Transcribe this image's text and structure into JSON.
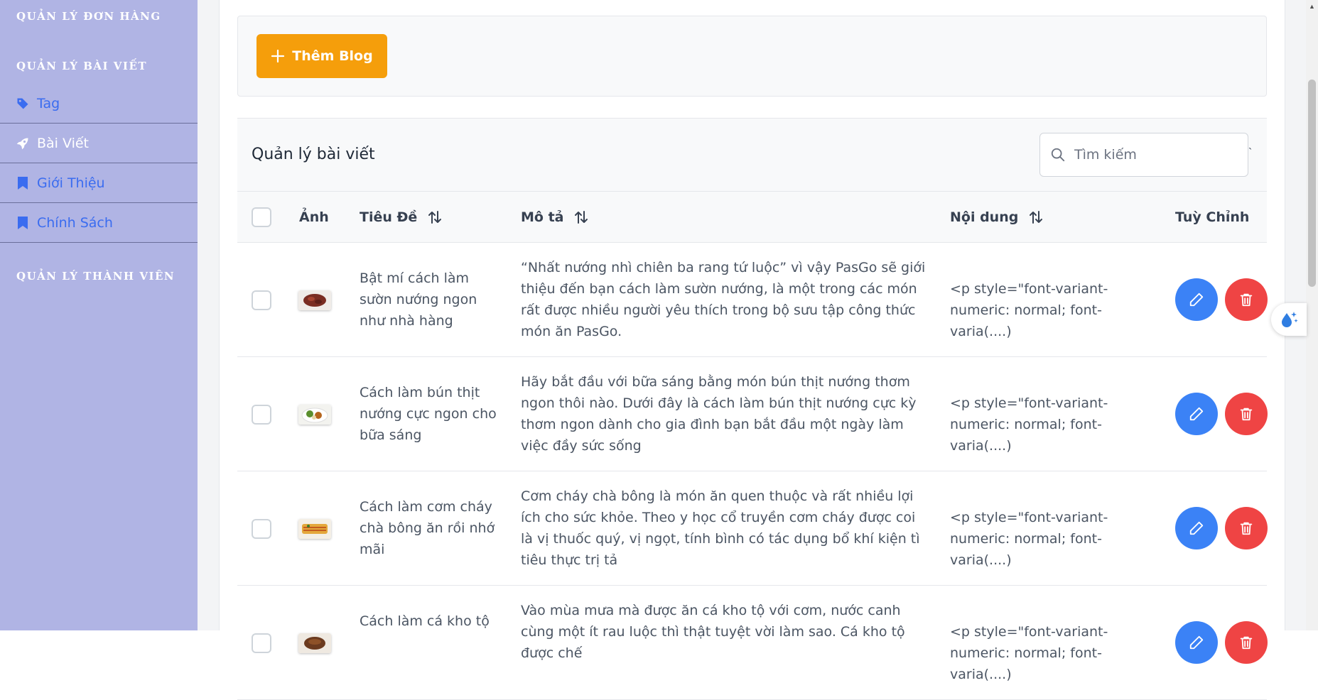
{
  "sidebar": {
    "sections": {
      "orders": "QUẢN LÝ ĐƠN HÀNG",
      "posts": "QUẢN LÝ BÀI VIẾT",
      "members": "QUẢN LÝ THÀNH VIÊN"
    },
    "items": [
      {
        "label": "Tag",
        "icon": "tag-icon"
      },
      {
        "label": "Bài Viết",
        "icon": "rocket-icon"
      },
      {
        "label": "Giới Thiệu",
        "icon": "bookmark-icon"
      },
      {
        "label": "Chính Sách",
        "icon": "bookmark-icon"
      }
    ]
  },
  "toolbar": {
    "add_label": "Thêm Blog"
  },
  "panel": {
    "title": "Quản lý bài viết",
    "search_placeholder": "Tìm kiếm",
    "tick": "`"
  },
  "table": {
    "headers": {
      "image": "Ảnh",
      "title": "Tiêu Đề",
      "desc": "Mô tả",
      "content": "Nội dung",
      "actions": "Tuỳ Chỉnh"
    },
    "rows": [
      {
        "title": "Bật mí cách làm sườn nướng ngon như nhà hàng",
        "desc": "“Nhất nướng nhì chiên ba rang tứ luộc” vì vậy PasGo sẽ giới thiệu đến bạn cách làm sườn nướng, là một trong các món rất được nhiều người yêu thích trong bộ sưu tập công thức món ăn PasGo.",
        "content": "<p style=\"font-variant-numeric: normal; font-varia(....)"
      },
      {
        "title": "Cách làm bún thịt nướng cực ngon cho bữa sáng",
        "desc": "Hãy bắt đầu với bữa sáng bằng món bún thịt nướng thơm ngon thôi nào. Dưới đây là cách làm bún thịt nướng cực kỳ thơm ngon dành cho gia đình bạn bắt đầu một ngày làm việc đầy sức sống",
        "content": "<p style=\"font-variant-numeric: normal; font-varia(....)"
      },
      {
        "title": "Cách làm cơm cháy chà bông ăn rồi nhớ mãi",
        "desc": "Cơm cháy chà bông là món ăn quen thuộc và rất nhiều lợi ích cho sức khỏe. Theo y học cổ truyền cơm cháy được coi là vị thuốc quý, vị ngọt, tính bình có tác dụng bổ khí kiện tì tiêu thực trị tả",
        "content": "<p style=\"font-variant-numeric: normal; font-varia(....)"
      },
      {
        "title": "Cách làm cá kho tộ",
        "desc": "Vào mùa mưa mà được ăn cá kho tộ với cơm, nước canh cùng một ít rau luộc thì thật tuyệt vời làm sao. Cá kho tộ được chế",
        "content": "<p style=\"font-variant-numeric: normal; font-varia(....)"
      }
    ]
  },
  "colors": {
    "sidebar_bg": "#b0b4e4",
    "accent_orange": "#f59e0b",
    "edit_blue": "#3b82f6",
    "delete_red": "#ef4444",
    "nav_blue": "#3a6cf0"
  }
}
